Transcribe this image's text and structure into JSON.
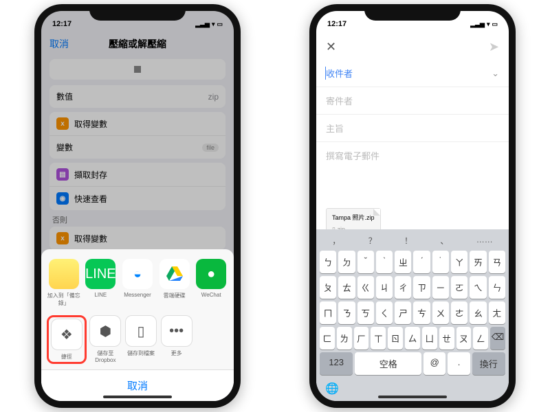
{
  "left": {
    "status_time": "12:17",
    "nav_cancel": "取消",
    "nav_title": "壓縮或解壓縮",
    "value_label": "數值",
    "value_content": "zip",
    "get_var": "取得變數",
    "var_label": "變數",
    "var_pill": "file",
    "extract_archive": "擷取封存",
    "quick_look": "快速查看",
    "else_label": "否則",
    "get_var2": "取得變數",
    "share": {
      "notes": "加入到「備忘錄」",
      "line": "LINE",
      "messenger": "Messenger",
      "drive": "雲端硬碟",
      "wechat": "WeChat",
      "shortcuts": "捷徑",
      "dropbox": "儲存至 Dropbox",
      "files": "儲存到檔案",
      "more": "更多"
    },
    "sheet_cancel": "取消"
  },
  "right": {
    "status_time": "12:17",
    "to_label": "收件者",
    "from_label": "寄件者",
    "subject_label": "主旨",
    "body_placeholder": "撰寫電子郵件",
    "attach_name": "Tampa 照片.zip",
    "attach_type": "zip",
    "suggestions": [
      "，",
      "？",
      "！",
      "、",
      "……"
    ],
    "row1": [
      "ㄅ",
      "ㄉ",
      "ˇ",
      "ˋ",
      "ㄓ",
      "ˊ",
      "˙",
      "ㄚ",
      "ㄞ",
      "ㄢ"
    ],
    "row2": [
      "ㄆ",
      "ㄊ",
      "ㄍ",
      "ㄐ",
      "ㄔ",
      "ㄗ",
      "ㄧ",
      "ㄛ",
      "ㄟ",
      "ㄣ"
    ],
    "row3": [
      "ㄇ",
      "ㄋ",
      "ㄎ",
      "ㄑ",
      "ㄕ",
      "ㄘ",
      "ㄨ",
      "ㄜ",
      "ㄠ",
      "ㄤ"
    ],
    "row4": [
      "ㄈ",
      "ㄌ",
      "ㄏ",
      "ㄒ",
      "ㄖ",
      "ㄙ",
      "ㄩ",
      "ㄝ",
      "ㄡ",
      "ㄥ"
    ],
    "num_key": "123",
    "space_key": "空格",
    "at_key": "@",
    "dot_key": ".",
    "return_key": "換行"
  }
}
